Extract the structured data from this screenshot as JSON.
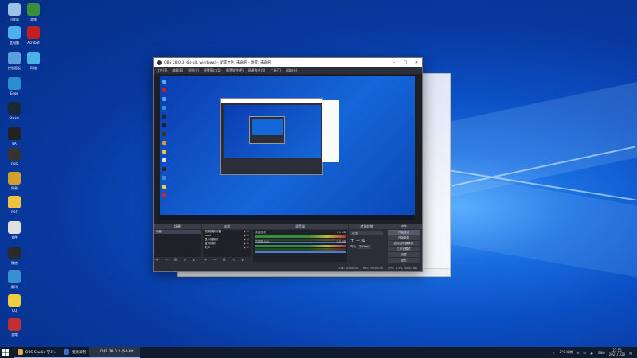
{
  "desktop": {
    "icons": [
      {
        "label": "回收站",
        "color": "#9cc3e6"
      },
      {
        "label": "游戏",
        "color": "#3a8f3a"
      },
      {
        "label": "此电脑",
        "color": "#4fb0f0"
      },
      {
        "label": "Acrobat",
        "color": "#c02020"
      },
      {
        "label": "控制面板",
        "color": "#5aa0e0"
      },
      {
        "label": "网络",
        "color": "#4ab0e8"
      },
      {
        "label": "Edge",
        "color": "#2a8fd0"
      },
      {
        "label": "Steam",
        "color": "#1b2838"
      },
      {
        "label": "EA",
        "color": "#222"
      },
      {
        "label": "OBS",
        "color": "#333"
      },
      {
        "label": "网易",
        "color": "#d0a030"
      },
      {
        "label": "PDF",
        "color": "#f0c040"
      },
      {
        "label": "文件",
        "color": "#e0e0e0"
      },
      {
        "label": "微信",
        "color": "#2a2a2a"
      },
      {
        "label": "腾讯",
        "color": "#3a8fd0"
      },
      {
        "label": "QQ",
        "color": "#f0d040"
      },
      {
        "label": "游戏",
        "color": "#c03030"
      }
    ]
  },
  "obs": {
    "title": "OBS 28.0.3 (64-bit, windows) - 配置文件: 未命名 - 场景: 未命名",
    "menu": [
      "文件(F)",
      "编辑(E)",
      "视图(V)",
      "停靠窗口(D)",
      "配置文件(P)",
      "场景集合(S)",
      "工具(T)",
      "帮助(H)"
    ],
    "docks": {
      "scenes": {
        "header": "场景",
        "items": [
          "场景"
        ]
      },
      "sources": {
        "header": "来源",
        "items": [
          "视频捕获设备",
          "Logo",
          "显示器捕获",
          "窗口捕获",
          "文本"
        ]
      },
      "mixer": {
        "header": "混音器",
        "channels": [
          {
            "name": "桌面音频",
            "level": "0.0 dB"
          },
          {
            "name": "麦克风/Aux",
            "level": "0.0 dB"
          }
        ]
      },
      "transitions": {
        "header": "转场特效",
        "type": "淡出",
        "duration_label": "时长",
        "duration": "300 ms"
      },
      "controls": {
        "header": "控件",
        "buttons": [
          "开始推流",
          "开始录制",
          "启动虚拟摄像机",
          "工作室模式",
          "设置",
          "退出"
        ]
      }
    },
    "status": [
      "LIVE: 00:00:00",
      "REC: 00:00:00",
      "CPU: 2.3%, 30.00 fps"
    ]
  },
  "taskbar": {
    "items": [
      {
        "label": "OBS Studio 学习...",
        "color": "#e0b040",
        "active": false
      },
      {
        "label": "视频录制",
        "color": "#3a6fd0",
        "active": false
      },
      {
        "label": "OBS 28.0.3 (64-bit...",
        "color": "#333",
        "active": true
      }
    ],
    "tray": {
      "weather": "2°C 晴朗",
      "lang": "ENG",
      "time": "23:15",
      "date": "2021/1/20"
    }
  },
  "colors": {
    "accent": "#0b4fc4",
    "obs_bg": "#2b2e38",
    "taskbar": "#101b2e"
  }
}
